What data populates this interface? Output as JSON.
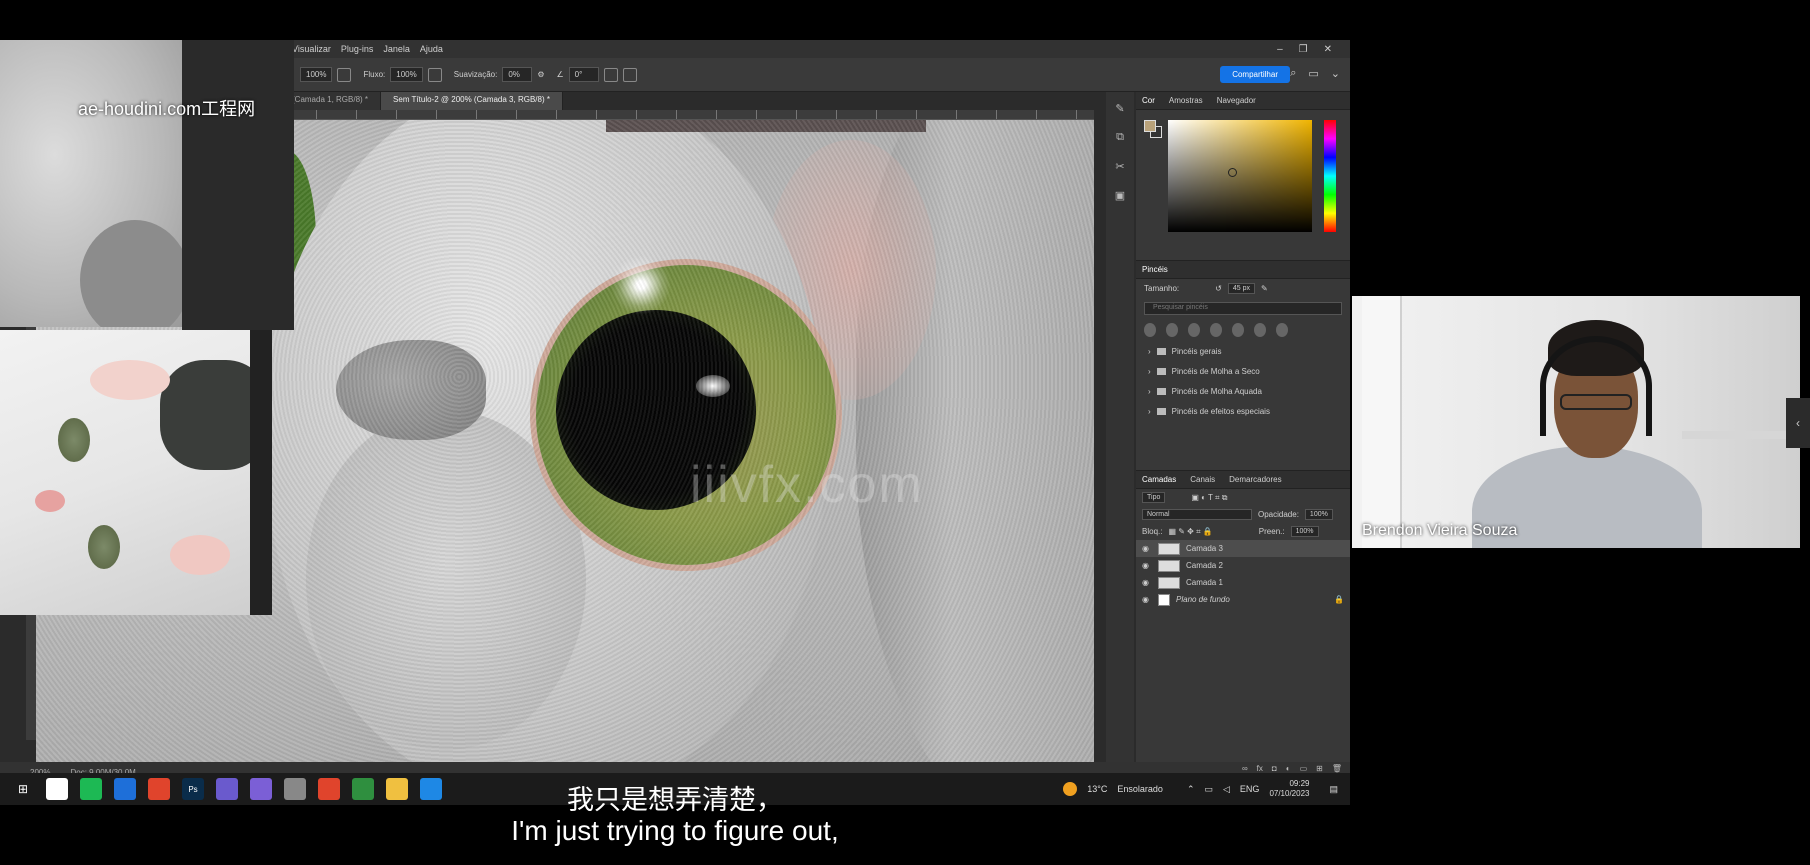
{
  "photoshop": {
    "menu": [
      "Visualizar",
      "Plug-ins",
      "Janela",
      "Ajuda"
    ],
    "options": {
      "zoom": "100%",
      "flow_label": "Fluxo:",
      "flow_value": "100%",
      "smoothing_label": "Suavização:",
      "smoothing_value": "0%",
      "angle": "0°"
    },
    "share_label": "Compartilhar",
    "tabs": [
      {
        "label": "(Camada 1, RGB/8) *"
      },
      {
        "label": "Sem Título-2 @ 200% (Camada 3, RGB/8) *"
      }
    ],
    "status": {
      "zoom": "200%",
      "doc": "Doc: 9,00M/30,0M"
    },
    "panels": {
      "color_tabs": [
        "Cor",
        "Amostras",
        "Navegador"
      ],
      "brush": {
        "title": "Pincéis",
        "size_label": "Tamanho:",
        "size_value": "45 px",
        "search_placeholder": "Pesquisar pincéis",
        "folders": [
          "Pincéis gerais",
          "Pincéis de Molha a Seco",
          "Pincéis de Molha Aquada",
          "Pincéis de efeitos especiais"
        ]
      },
      "layers": {
        "tabs": [
          "Camadas",
          "Canais",
          "Demarcadores"
        ],
        "filter": "Tipo",
        "blend": "Normal",
        "opacity_label": "Opacidade:",
        "opacity_value": "100%",
        "lock_label": "Bloq.:",
        "fill_label": "Preen.:",
        "fill_value": "100%",
        "items": [
          {
            "name": "Camada 3",
            "selected": true
          },
          {
            "name": "Camada 2",
            "selected": false
          },
          {
            "name": "Camada 1",
            "selected": false
          },
          {
            "name": "Plano de fundo",
            "selected": false
          }
        ]
      }
    }
  },
  "taskbar": {
    "apps": [
      {
        "icon": "photos-icon",
        "label": "",
        "color": "#ffffff"
      },
      {
        "icon": "spotify-icon",
        "label": "",
        "color": "#1db954"
      },
      {
        "icon": "app-blue-icon",
        "label": "",
        "color": "#1e6fd9"
      },
      {
        "icon": "chrome-icon",
        "label": "",
        "color": "#e0442c"
      },
      {
        "icon": "photoshop-icon",
        "label": "Ps",
        "color": "#0a2c4a"
      },
      {
        "icon": "app-purple-icon",
        "label": "",
        "color": "#6a5acd"
      },
      {
        "icon": "app-violet-icon",
        "label": "",
        "color": "#7b5fd6"
      },
      {
        "icon": "app-gray-icon",
        "label": "",
        "color": "#888888"
      },
      {
        "icon": "chrome-icon",
        "label": "",
        "color": "#e0442c"
      },
      {
        "icon": "app-green-icon",
        "label": "",
        "color": "#2f8f3f"
      },
      {
        "icon": "explorer-icon",
        "label": "",
        "color": "#f0c040"
      },
      {
        "icon": "app-blue2-icon",
        "label": "",
        "color": "#1e88e5"
      }
    ],
    "weather_temp": "13°C",
    "weather_text": "Ensolarado",
    "lang": "ENG",
    "time": "09:29",
    "date": "07/10/2023"
  },
  "watermark_top": "ae-houdini.com工程网",
  "watermark_center": "iiivfx.com",
  "webcam_name": "Brendon Vieira Souza",
  "subtitle_cn": "我只是想弄清楚，",
  "subtitle_en": "I'm just trying to figure out,"
}
